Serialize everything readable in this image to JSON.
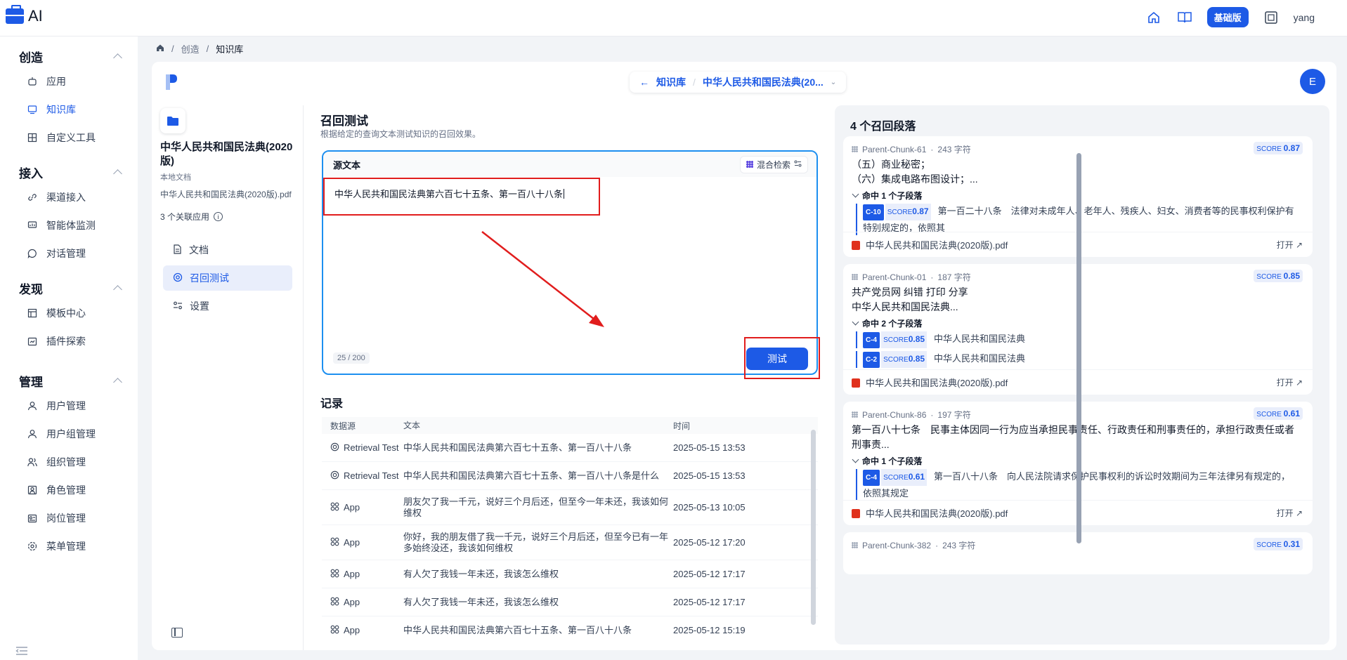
{
  "header": {
    "logo_text": "AI",
    "plan_badge": "基础版",
    "username": "yang",
    "icons": [
      "home-icon",
      "book-icon",
      "fullscreen-icon"
    ]
  },
  "sidebar": {
    "groups": [
      {
        "title": "创造",
        "items": [
          {
            "label": "应用",
            "icon": "robot-icon"
          },
          {
            "label": "知识库",
            "icon": "monitor-icon",
            "active": true
          },
          {
            "label": "自定义工具",
            "icon": "tool-icon"
          }
        ]
      },
      {
        "title": "接入",
        "items": [
          {
            "label": "渠道接入",
            "icon": "link-icon"
          },
          {
            "label": "智能体监测",
            "icon": "monitor-chart-icon"
          },
          {
            "label": "对话管理",
            "icon": "chat-icon"
          }
        ]
      },
      {
        "title": "发现",
        "items": [
          {
            "label": "模板中心",
            "icon": "template-icon"
          },
          {
            "label": "插件探索",
            "icon": "plugin-icon"
          }
        ]
      },
      {
        "title": "管理",
        "items": [
          {
            "label": "用户管理",
            "icon": "user-icon"
          },
          {
            "label": "用户组管理",
            "icon": "user-group-icon"
          },
          {
            "label": "组织管理",
            "icon": "org-icon"
          },
          {
            "label": "角色管理",
            "icon": "role-icon"
          },
          {
            "label": "岗位管理",
            "icon": "post-icon"
          },
          {
            "label": "菜单管理",
            "icon": "menu-gear-icon"
          }
        ]
      }
    ]
  },
  "breadcrumb": {
    "items": [
      "创造",
      "知识库"
    ]
  },
  "navpill": {
    "back_label": "知识库",
    "current": "中华人民共和国民法典(20..."
  },
  "avatar_letter": "E",
  "kb": {
    "title": "中华人民共和国民法典(2020版)",
    "subtitle": "本地文档",
    "file": "中华人民共和国民法典(2020版).pdf",
    "apps": "3 个关联应用",
    "nav": [
      {
        "label": "文档",
        "icon": "document-icon"
      },
      {
        "label": "召回测试",
        "icon": "target-icon",
        "active": true
      },
      {
        "label": "设置",
        "icon": "settings-icon"
      }
    ]
  },
  "retrieval": {
    "title": "召回测试",
    "desc": "根据给定的查询文本测试知识的召回效果。",
    "source_label": "源文本",
    "mode_label": "混合检索",
    "query": "中华人民共和国民法典第六百七十五条、第一百八十八条",
    "count": "25",
    "limit": "200",
    "test_button": "测试"
  },
  "records": {
    "title": "记录",
    "headers": [
      "数据源",
      "文本",
      "时间"
    ],
    "rows": [
      {
        "source": "Retrieval Test",
        "type": "retrieval",
        "text": "中华人民共和国民法典第六百七十五条、第一百八十八条",
        "time": "2025-05-15 13:53"
      },
      {
        "source": "Retrieval Test",
        "type": "retrieval",
        "text": "中华人民共和国民法典第六百七十五条、第一百八十八条是什么",
        "time": "2025-05-15 13:53"
      },
      {
        "source": "App",
        "type": "app",
        "text": "朋友欠了我一千元，说好三个月后还，但至今一年未还，我该如何维权",
        "time": "2025-05-13 10:05"
      },
      {
        "source": "App",
        "type": "app",
        "text": "你好，我的朋友借了我一千元，说好三个月后还，但至今已有一年多始终没还，我该如何维权",
        "time": "2025-05-12 17:20"
      },
      {
        "source": "App",
        "type": "app",
        "text": "有人欠了我钱一年未还，我该怎么维权",
        "time": "2025-05-12 17:17"
      },
      {
        "source": "App",
        "type": "app",
        "text": "有人欠了我钱一年未还，我该怎么维权",
        "time": "2025-05-12 17:17"
      },
      {
        "source": "App",
        "type": "app",
        "text": "中华人民共和国民法典第六百七十五条、第一百八十八条",
        "time": "2025-05-12 15:19"
      }
    ]
  },
  "results": {
    "title": "4 个召回段落",
    "score_label": "SCORE",
    "open_label": "打开",
    "cards": [
      {
        "chunk": "Parent-Chunk-61",
        "chars": "243 字符",
        "score": "0.87",
        "body": [
          "（五）商业秘密；",
          "（六）集成电路布图设计；..."
        ],
        "hit": "命中 1 个子段落",
        "children": [
          {
            "tag": "C-10",
            "score": "0.87",
            "text": "第一百二十八条　法律对未成年人、老年人、残疾人、妇女、消费者等的民事权利保护有特别规定的，依照其"
          }
        ],
        "file": "中华人民共和国民法典(2020版).pdf"
      },
      {
        "chunk": "Parent-Chunk-01",
        "chars": "187 字符",
        "score": "0.85",
        "body": [
          "共产党员网 纠错 打印 分享",
          "中华人民共和国民法典..."
        ],
        "hit": "命中 2 个子段落",
        "children": [
          {
            "tag": "C-4",
            "score": "0.85",
            "text": "中华人民共和国民法典"
          },
          {
            "tag": "C-2",
            "score": "0.85",
            "text": "中华人民共和国民法典"
          }
        ],
        "file": "中华人民共和国民法典(2020版).pdf"
      },
      {
        "chunk": "Parent-Chunk-86",
        "chars": "197 字符",
        "score": "0.61",
        "body": [
          "第一百八十七条　民事主体因同一行为应当承担民事责任、行政责任和刑事责任的，承担行政责任或者刑事责..."
        ],
        "hit": "命中 1 个子段落",
        "children": [
          {
            "tag": "C-4",
            "score": "0.61",
            "text": "第一百八十八条　向人民法院请求保护民事权利的诉讼时效期间为三年法律另有规定的，依照其规定"
          }
        ],
        "file": "中华人民共和国民法典(2020版).pdf"
      },
      {
        "chunk": "Parent-Chunk-382",
        "chars": "243 字符",
        "score": "0.31"
      }
    ]
  }
}
